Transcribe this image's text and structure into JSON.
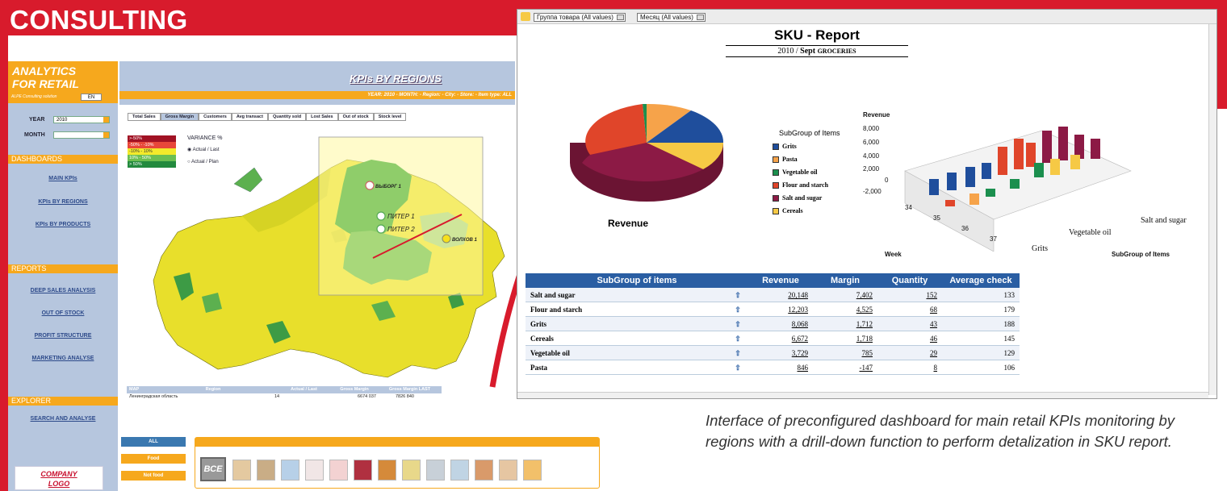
{
  "banner": {
    "title": "CONSULTING"
  },
  "dashboard": {
    "brand_line1": "ANALYTICS",
    "brand_line2": "FOR RETAIL",
    "brand_sub": "ALPE Consulting solution",
    "lang": "EN",
    "year_label": "YEAR",
    "year_value": "2010",
    "month_label": "MONTH",
    "month_value": "",
    "sections": {
      "dashboards": "DASHBOARDS",
      "reports": "REPORTS",
      "explorer": "EXPLORER"
    },
    "nav": {
      "main_kpis": "MAIN KPIs",
      "kpis_regions": "KPIs BY REGIONS",
      "kpis_products": "KPIs BY PRODUCTS",
      "deep_sales": "DEEP SALES ANALYSIS",
      "out_of_stock": "OUT OF STOCK",
      "profit_structure": "PROFIT STRUCTURE",
      "marketing": "MARKETING ANALYSE",
      "search": "SEARCH AND ANALYSE"
    },
    "logo_line1": "COMPANY",
    "logo_line2": "LOGO",
    "header_title": "KPIs BY REGIONS",
    "filter_line": "YEAR: 2010  -  MONTH:   -  Region:  -  City:  -  Store:  -  Item type: ALL",
    "tabs": [
      "Total Sales",
      "Gross Margin",
      "Customers",
      "Avg transact",
      "Quantity sold",
      "Lost Sales",
      "Out of stock",
      "Stock level"
    ],
    "legend": [
      {
        "label": ">-50%",
        "color": "#a11224"
      },
      {
        "label": "-50% - -10%",
        "color": "#e8473a"
      },
      {
        "label": "-10% - 10%",
        "color": "#f3ea2b"
      },
      {
        "label": "10% - 50%",
        "color": "#6bbf52"
      },
      {
        "label": "> 50%",
        "color": "#238a3e"
      }
    ],
    "variance_title": "VARIANCE %",
    "radio_actual_last": "Actual / Last",
    "radio_actual_plan": "Actual / Plan",
    "map_labels": {
      "vyborg": "ВЫБОРГ 1",
      "piter1": "ПИТЕР 1",
      "piter2": "ПИТЕР 2",
      "volkhov": "ВОЛХОВ 1"
    },
    "table": {
      "map_col": "MAP",
      "headers": [
        "Region",
        "Actual / Last",
        "Gross Margin",
        "Gross Margin LAST"
      ],
      "row": [
        "Ленинградская область",
        "14",
        "6674 037",
        "7826 840"
      ]
    },
    "categories": [
      "ALL",
      "Food",
      "Not food"
    ],
    "bce_label": "ВСЕ"
  },
  "sku_report": {
    "dropdown1": "Группа товара (All values)",
    "dropdown2": "Месяц (All values)",
    "title": "SKU - Report",
    "subtitle_year": "2010 /",
    "subtitle_month": "Sept",
    "subtitle_group": "GROCERIES",
    "pie_title": "Revenue",
    "legend_title": "SubGroup of Items",
    "legend": [
      {
        "label": "Grits",
        "color": "#1f4e9c"
      },
      {
        "label": "Pasta",
        "color": "#f6a34a"
      },
      {
        "label": "Vegetable oil",
        "color": "#1b8f4e"
      },
      {
        "label": "Flour and starch",
        "color": "#e0452a"
      },
      {
        "label": "Salt and sugar",
        "color": "#8c1a45"
      },
      {
        "label": "Cereals",
        "color": "#f6c945"
      }
    ],
    "bar3d": {
      "ylabel": "Revenue",
      "yticks": [
        "8,000",
        "6,000",
        "4,000",
        "2,000",
        "0",
        "-2,000"
      ],
      "weeks": [
        "34",
        "35",
        "36",
        "37"
      ],
      "week_label": "Week",
      "axis_groups": [
        "Salt and sugar",
        "Vegetable oil",
        "Grits"
      ],
      "group_label": "SubGroup of Items"
    },
    "table": {
      "headers": [
        "SubGroup of items",
        "Revenue",
        "Margin",
        "Quantity",
        "Average check"
      ],
      "rows": [
        [
          "Salt and sugar",
          "20,148",
          "7,402",
          "152",
          "133"
        ],
        [
          "Flour and starch",
          "12,203",
          "4,525",
          "68",
          "179"
        ],
        [
          "Grits",
          "8,068",
          "1,712",
          "43",
          "188"
        ],
        [
          "Cereals",
          "6,672",
          "1,718",
          "46",
          "145"
        ],
        [
          "Vegetable oil",
          "3,729",
          "785",
          "29",
          "129"
        ],
        [
          "Pasta",
          "846",
          "-147",
          "8",
          "106"
        ]
      ]
    }
  },
  "caption": "Interface of preconfigured dashboard for main retail KPIs monitoring by regions with a drill-down function to perform detalization in SKU report."
}
